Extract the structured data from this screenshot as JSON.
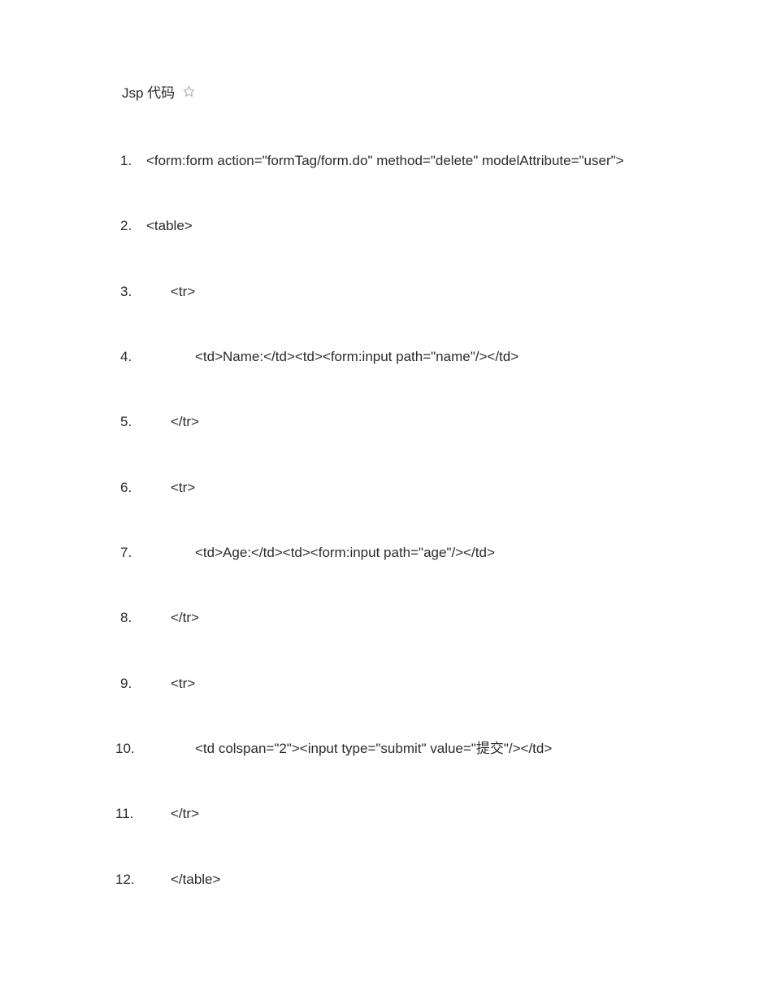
{
  "header": {
    "title": "Jsp 代码",
    "starIcon": "star-icon"
  },
  "code": {
    "lines": [
      "<form:form action=\"formTag/form.do\" method=\"delete\" modelAttribute=\"user\">",
      "<table>",
      "<tr>",
      "<td>Name:</td><td><form:input path=\"name\"/></td>",
      "</tr>",
      "<tr>",
      "<td>Age:</td><td><form:input path=\"age\"/></td>",
      "</tr>",
      "<tr>",
      "<td colspan=\"2\"><input type=\"submit\" value=\"提交\"/></td>",
      "</tr>",
      "</table>"
    ],
    "indent": [
      0,
      0,
      1,
      2,
      1,
      1,
      2,
      1,
      1,
      2,
      1,
      1
    ]
  }
}
